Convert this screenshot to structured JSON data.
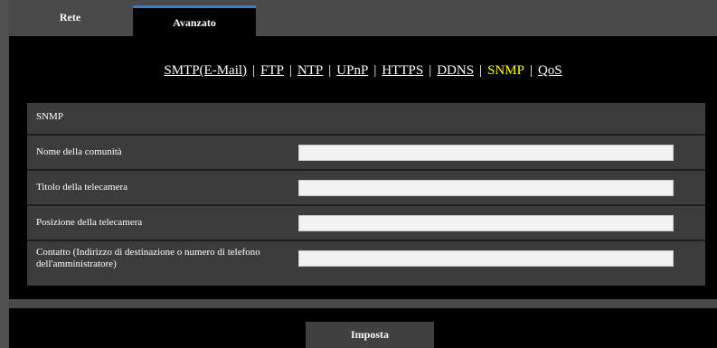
{
  "tabs": [
    {
      "label": "Rete",
      "active": false
    },
    {
      "label": "Avanzato",
      "active": true
    }
  ],
  "subnav": {
    "items": [
      "SMTP(E-Mail)",
      "FTP",
      "NTP",
      "UPnP",
      "HTTPS",
      "DDNS",
      "SNMP",
      "QoS"
    ],
    "active": "SNMP",
    "separator": "|"
  },
  "snmp": {
    "title": "SNMP",
    "fields": [
      {
        "label": "Nome della comunità",
        "value": ""
      },
      {
        "label": "Titolo della telecamera",
        "value": ""
      },
      {
        "label": "Posizione della telecamera",
        "value": ""
      },
      {
        "label": "Contatto (Indirizzo di destinazione o numero di telefono dell'amministratore)",
        "value": ""
      }
    ]
  },
  "submit_label": "Imposta",
  "colors": {
    "active_link": "#ffff00",
    "tab_accent": "#3d7fc4",
    "panel": "#3c3c3c",
    "background": "#000000"
  }
}
